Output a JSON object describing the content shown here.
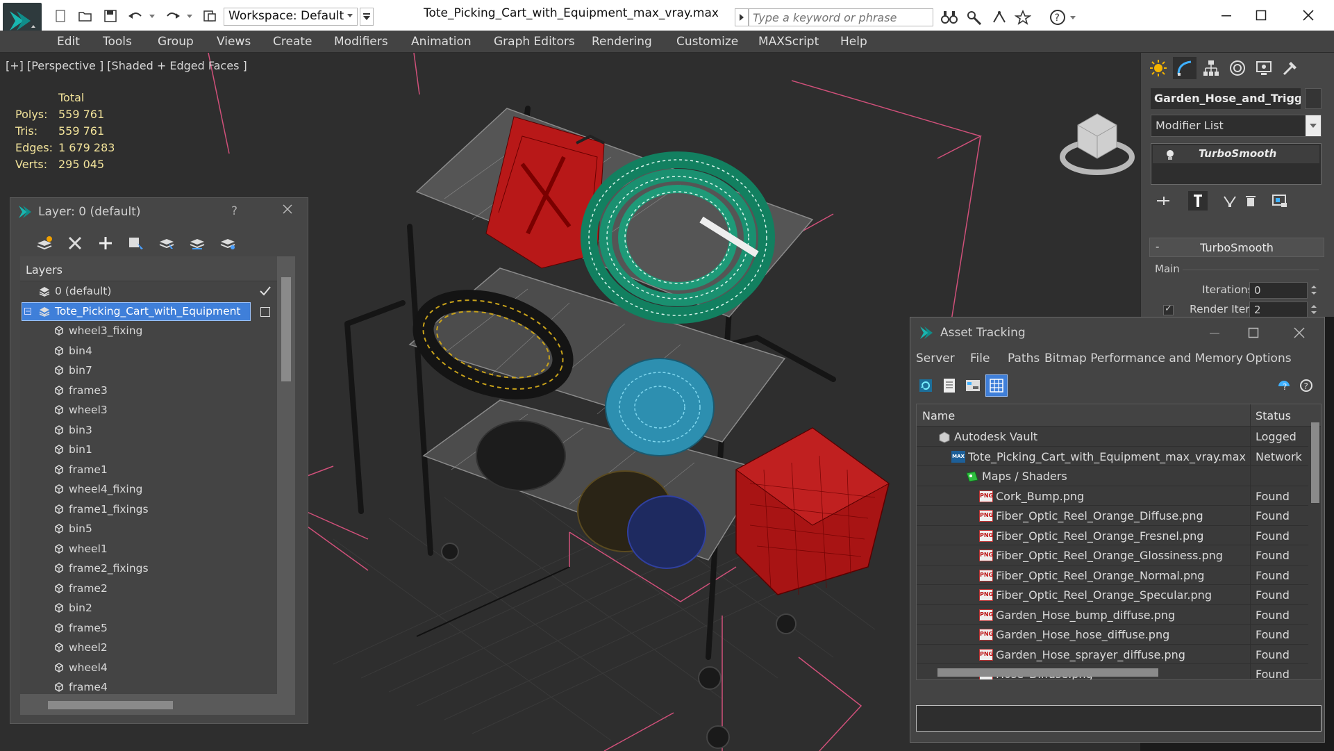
{
  "app": {
    "workspace": "Workspace: Default",
    "document_title": "Tote_Picking_Cart_with_Equipment_max_vray.max",
    "search_placeholder": "Type a keyword or phrase"
  },
  "menu": [
    "Edit",
    "Tools",
    "Group",
    "Views",
    "Create",
    "Modifiers",
    "Animation",
    "Graph Editors",
    "Rendering",
    "Customize",
    "MAXScript",
    "Help"
  ],
  "viewport": {
    "label": "[+] [Perspective ] [Shaded + Edged Faces ]",
    "stats": {
      "header": "Total",
      "rows": [
        {
          "label": "Polys:",
          "value": "559 761"
        },
        {
          "label": "Tris:",
          "value": "559 761"
        },
        {
          "label": "Edges:",
          "value": "1 679 283"
        },
        {
          "label": "Verts:",
          "value": "295 045"
        }
      ]
    }
  },
  "layer_panel": {
    "title": "Layer: 0 (default)",
    "help": "?",
    "list_header": "Layers",
    "layers": [
      {
        "name": "0 (default)",
        "level": 0
      },
      {
        "name": "Tote_Picking_Cart_with_Equipment",
        "level": 0,
        "selected": true
      },
      {
        "name": "wheel3_fixing",
        "level": 1
      },
      {
        "name": "bin4",
        "level": 1
      },
      {
        "name": "bin7",
        "level": 1
      },
      {
        "name": "frame3",
        "level": 1
      },
      {
        "name": "wheel3",
        "level": 1
      },
      {
        "name": "bin3",
        "level": 1
      },
      {
        "name": "bin1",
        "level": 1
      },
      {
        "name": "frame1",
        "level": 1
      },
      {
        "name": "wheel4_fixing",
        "level": 1
      },
      {
        "name": "frame1_fixings",
        "level": 1
      },
      {
        "name": "bin5",
        "level": 1
      },
      {
        "name": "wheel1",
        "level": 1
      },
      {
        "name": "frame2_fixings",
        "level": 1
      },
      {
        "name": "frame2",
        "level": 1
      },
      {
        "name": "bin2",
        "level": 1
      },
      {
        "name": "frame5",
        "level": 1
      },
      {
        "name": "wheel2",
        "level": 1
      },
      {
        "name": "wheel4",
        "level": 1
      },
      {
        "name": "frame4",
        "level": 1
      }
    ]
  },
  "command_panel": {
    "object_name": "Garden_Hose_and_Trigger_Nozzle",
    "modifier_list": "Modifier List",
    "stack_item": "TurboSmooth",
    "rollout_title": "TurboSmooth",
    "rollout_minus": "-",
    "group_main": "Main",
    "iterations_label": "Iterations:",
    "iterations_value": "0",
    "render_iters_label": "Render Iters:",
    "render_iters_value": "2"
  },
  "asset_tracking": {
    "title": "Asset Tracking",
    "menu": [
      "Server",
      "File",
      "Paths",
      "Bitmap Performance and Memory",
      "Options"
    ],
    "col_name": "Name",
    "col_status": "Status",
    "rows": [
      {
        "name": "Autodesk Vault",
        "status": "Logged",
        "level": 0,
        "icon": "vault"
      },
      {
        "name": "Tote_Picking_Cart_with_Equipment_max_vray.max",
        "status": "Network",
        "level": 1,
        "icon": "max"
      },
      {
        "name": "Maps / Shaders",
        "status": "",
        "level": 2,
        "icon": "maps"
      },
      {
        "name": "Cork_Bump.png",
        "status": "Found",
        "level": 3,
        "icon": "png"
      },
      {
        "name": "Fiber_Optic_Reel_Orange_Diffuse.png",
        "status": "Found",
        "level": 3,
        "icon": "png"
      },
      {
        "name": "Fiber_Optic_Reel_Orange_Fresnel.png",
        "status": "Found",
        "level": 3,
        "icon": "png"
      },
      {
        "name": "Fiber_Optic_Reel_Orange_Glossiness.png",
        "status": "Found",
        "level": 3,
        "icon": "png"
      },
      {
        "name": "Fiber_Optic_Reel_Orange_Normal.png",
        "status": "Found",
        "level": 3,
        "icon": "png"
      },
      {
        "name": "Fiber_Optic_Reel_Orange_Specular.png",
        "status": "Found",
        "level": 3,
        "icon": "png"
      },
      {
        "name": "Garden_Hose_bump_diffuse.png",
        "status": "Found",
        "level": 3,
        "icon": "png"
      },
      {
        "name": "Garden_Hose_hose_diffuse.png",
        "status": "Found",
        "level": 3,
        "icon": "png"
      },
      {
        "name": "Garden_Hose_sprayer_diffuse.png",
        "status": "Found",
        "level": 3,
        "icon": "png"
      },
      {
        "name": "Hose_Diffuse.png",
        "status": "Found",
        "level": 3,
        "icon": "png"
      }
    ],
    "png_icon_text": "PNG",
    "max_icon_text": "MAX"
  },
  "colors": {
    "selection": "#3f7fd9",
    "stats_text": "#f2e39a",
    "viewport_bg": "#2e2e2e",
    "panel_bg": "#464646"
  }
}
